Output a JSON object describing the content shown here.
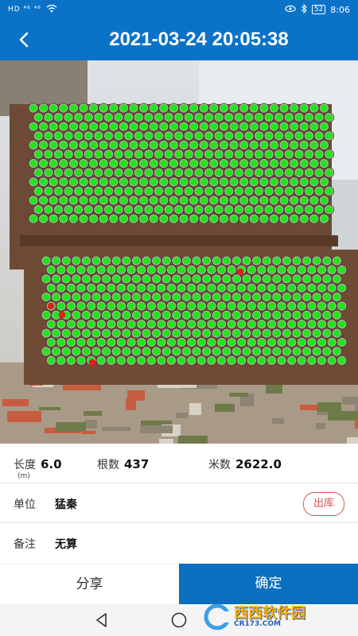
{
  "status_bar": {
    "left_text": "HD ⁴⁶ ⁴⁶",
    "battery": "52",
    "time": "8:06"
  },
  "header": {
    "title": "2021-03-24 20:05:38"
  },
  "photo": {
    "description": "stack-of-pipes-with-detection-marks",
    "marker_colors": {
      "detected": "#22e41e",
      "flagged": "#e01e1e"
    }
  },
  "metrics": {
    "length_label": "长度",
    "length_value": "6.0",
    "length_unit": "(m)",
    "count_label": "根数",
    "count_value": "437",
    "meters_label": "米数",
    "meters_value": "2622.0"
  },
  "unit_row": {
    "label": "单位",
    "value": "猛秦",
    "outbound_label": "出库"
  },
  "note_row": {
    "label": "备注",
    "value": "无算"
  },
  "actions": {
    "share_label": "分享",
    "confirm_label": "确定"
  },
  "watermark": {
    "text": "西西软件园",
    "sub": "CR173.COM"
  },
  "colors": {
    "primary": "#0a73c8",
    "danger": "#d9534f"
  }
}
